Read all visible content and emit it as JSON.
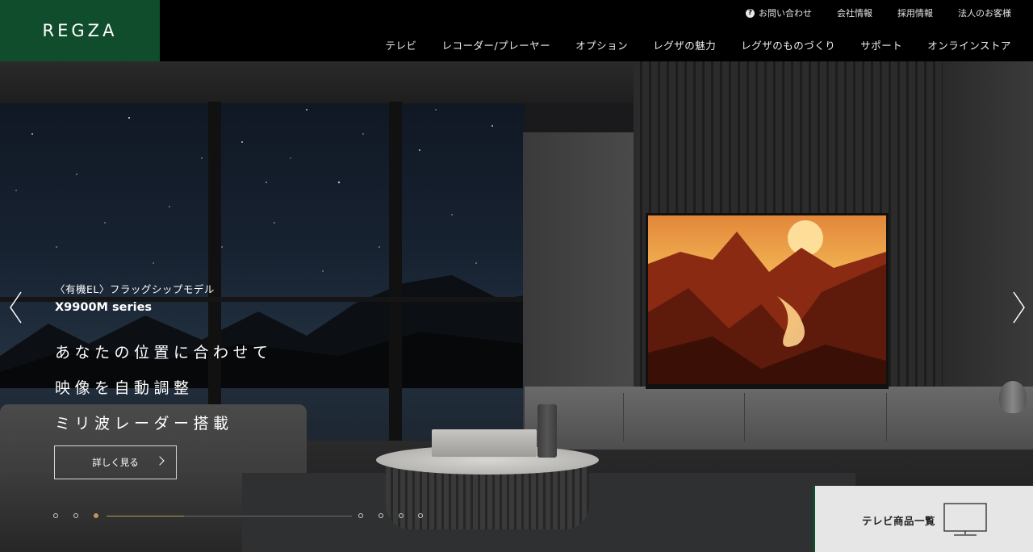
{
  "brand": {
    "logo_text": "REGZA",
    "brand_color": "#0f4d2c",
    "accent_color": "#b79b59"
  },
  "utility_nav": {
    "items": [
      {
        "label": "お問い合わせ",
        "icon": "question-circle-icon"
      },
      {
        "label": "会社情報"
      },
      {
        "label": "採用情報"
      },
      {
        "label": "法人のお客様"
      }
    ]
  },
  "main_nav": {
    "items": [
      {
        "label": "テレビ"
      },
      {
        "label": "レコーダー/プレーヤー"
      },
      {
        "label": "オプション"
      },
      {
        "label": "レグザの魅力"
      },
      {
        "label": "レグザのものづくり"
      },
      {
        "label": "サポート"
      },
      {
        "label": "オンラインストア"
      }
    ]
  },
  "hero": {
    "eyebrow": "〈有機EL〉フラッグシップモデル",
    "model": "X9900M series",
    "headline": [
      "あなたの位置に合わせて",
      "映像を自動調整",
      "ミリ波レーダー搭載"
    ],
    "cta_label": "詳しく見る",
    "prev_icon": "chevron-left-icon",
    "next_icon": "chevron-right-icon",
    "slide_count": 7,
    "active_slide": 3
  },
  "product_tab": {
    "label": "テレビ商品一覧",
    "icon": "tv-icon"
  }
}
